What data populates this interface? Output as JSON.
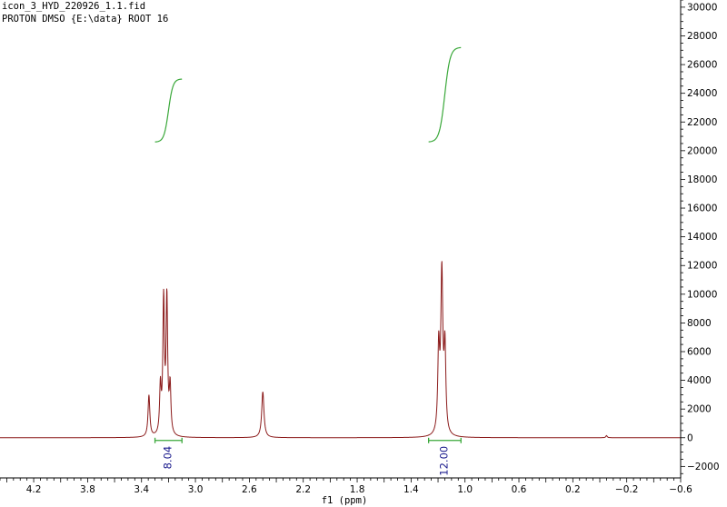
{
  "header": {
    "line1": "icon_3_HYD_220926_1.1.fid",
    "line2": "PROTON DMSO {E:\\data} ROOT 16"
  },
  "colors": {
    "spectrum": "#8b1a1a",
    "integral_curve": "#3aa83a",
    "integral_bracket": "#3aa83a",
    "integral_value": "#1a1a8c",
    "axis": "#000000"
  },
  "chart_data": {
    "type": "line",
    "xlabel": "f1 (ppm)",
    "x_reversed": true,
    "xlim": [
      4.45,
      -0.6
    ],
    "ylim": [
      -2800,
      30500
    ],
    "x_ticks": [
      4.2,
      3.8,
      3.4,
      3.0,
      2.6,
      2.2,
      1.8,
      1.4,
      1.0,
      0.6,
      0.2,
      -0.2,
      -0.6
    ],
    "x_tick_labels": [
      "4.2",
      "3.8",
      "3.4",
      "3.0",
      "2.6",
      "2.2",
      "1.8",
      "1.4",
      "1.0",
      "0.6",
      "0.2",
      "−0.2",
      "−0.6"
    ],
    "y_axis_position": "right",
    "y_ticks": [
      -2000,
      0,
      2000,
      4000,
      6000,
      8000,
      10000,
      12000,
      14000,
      16000,
      18000,
      20000,
      22000,
      24000,
      26000,
      28000,
      30000
    ],
    "y_tick_labels": [
      "−2000",
      "0",
      "2000",
      "4000",
      "6000",
      "8000",
      "10000",
      "12000",
      "14000",
      "16000",
      "18000",
      "20000",
      "22000",
      "24000",
      "26000",
      "28000",
      "30000"
    ],
    "peaks": [
      {
        "ppm": 3.345,
        "height": 2900,
        "width": 0.008
      },
      {
        "ppm": 3.26,
        "height": 3300,
        "width": 0.007
      },
      {
        "ppm": 3.236,
        "height": 9300,
        "width": 0.007
      },
      {
        "ppm": 3.212,
        "height": 9400,
        "width": 0.007
      },
      {
        "ppm": 3.188,
        "height": 3300,
        "width": 0.007
      },
      {
        "ppm": 2.5,
        "height": 3200,
        "width": 0.01
      },
      {
        "ppm": 1.195,
        "height": 5800,
        "width": 0.008
      },
      {
        "ppm": 1.172,
        "height": 11100,
        "width": 0.009
      },
      {
        "ppm": 1.149,
        "height": 5800,
        "width": 0.008
      },
      {
        "ppm": -0.05,
        "height": 150,
        "width": 0.006
      }
    ],
    "integrals": [
      {
        "from_ppm": 3.3,
        "to_ppm": 3.1,
        "value": "8.04",
        "curve_start": 20600,
        "curve_end": 25000
      },
      {
        "from_ppm": 1.27,
        "to_ppm": 1.03,
        "value": "12.00",
        "curve_start": 20600,
        "curve_end": 27200
      }
    ]
  }
}
